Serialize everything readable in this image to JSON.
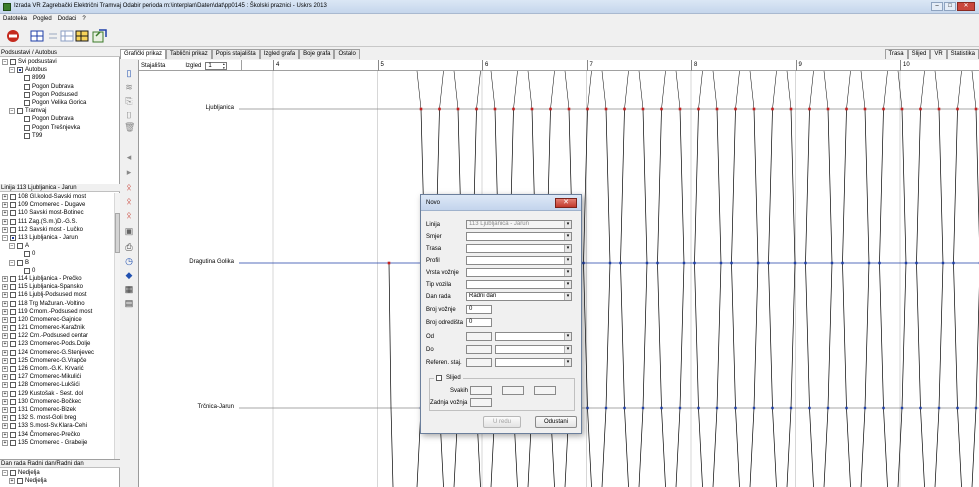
{
  "window": {
    "title": "Izrada VR  Zagrebački Električni Tramvaj Odabir perioda m:\\interplan\\Daten\\dat\\pp0145 : Školski praznici - Uskrs 2013",
    "minimize": "–",
    "maximize": "□",
    "close": "✕"
  },
  "menu": [
    "Datoteka",
    "Pogled",
    "Dodaci",
    "?"
  ],
  "left": {
    "section1_header": "Podsustavi / Autobus",
    "section1": [
      {
        "label": "Svi podsustavi",
        "level": 0,
        "toggle": "−",
        "check": "empty"
      },
      {
        "label": "Autobus",
        "level": 1,
        "toggle": "−",
        "check": "filled"
      },
      {
        "label": "8999",
        "level": 2,
        "toggle": "",
        "check": "empty"
      },
      {
        "label": "Pogon Dubrava",
        "level": 2,
        "toggle": "",
        "check": "empty"
      },
      {
        "label": "Pogon Podsused",
        "level": 2,
        "toggle": "",
        "check": "empty"
      },
      {
        "label": "Pogon Velika Gorica",
        "level": 2,
        "toggle": "",
        "check": "empty"
      },
      {
        "label": "Tramvaj",
        "level": 1,
        "toggle": "−",
        "check": "empty"
      },
      {
        "label": "Pogon Dubrava",
        "level": 2,
        "toggle": "",
        "check": "empty"
      },
      {
        "label": "Pogon Trešnjevka",
        "level": 2,
        "toggle": "",
        "check": "empty"
      },
      {
        "label": "T99",
        "level": 2,
        "toggle": "",
        "check": "empty"
      }
    ],
    "section2_header": "Linija  113 Ljubljanica - Jarun",
    "section2": [
      {
        "label": "108 Gl.kolod-Savski most",
        "level": 0,
        "toggle": "+",
        "check": "empty"
      },
      {
        "label": "109 Črnomerec - Dugave",
        "level": 0,
        "toggle": "+",
        "check": "empty"
      },
      {
        "label": "110 Savski most-Botinec",
        "level": 0,
        "toggle": "+",
        "check": "empty"
      },
      {
        "label": "111 Zag.(S.m.)D.-G.S.",
        "level": 0,
        "toggle": "+",
        "check": "empty"
      },
      {
        "label": "112 Savski most - Lučko",
        "level": 0,
        "toggle": "+",
        "check": "empty"
      },
      {
        "label": "113 Ljubljanica - Jarun",
        "level": 0,
        "toggle": "−",
        "check": "filled"
      },
      {
        "label": "A",
        "level": 1,
        "toggle": "−",
        "check": "empty"
      },
      {
        "label": "0",
        "level": 2,
        "toggle": "",
        "check": "empty"
      },
      {
        "label": "B",
        "level": 1,
        "toggle": "−",
        "check": "empty"
      },
      {
        "label": "0",
        "level": 2,
        "toggle": "",
        "check": "empty"
      },
      {
        "label": "114 Ljubljanica - Prečko",
        "level": 0,
        "toggle": "+",
        "check": "empty"
      },
      {
        "label": "115 Ljubljanica-Špansko",
        "level": 0,
        "toggle": "+",
        "check": "empty"
      },
      {
        "label": "116 Ljublj-Podsused most",
        "level": 0,
        "toggle": "+",
        "check": "empty"
      },
      {
        "label": "118 Trg Mažuran.-Voltino",
        "level": 0,
        "toggle": "+",
        "check": "empty"
      },
      {
        "label": "119 Črnom.-Podsused most",
        "level": 0,
        "toggle": "+",
        "check": "empty"
      },
      {
        "label": "120 Črnomerec-Gajnice",
        "level": 0,
        "toggle": "+",
        "check": "empty"
      },
      {
        "label": "121 Črnomerec-Karažnik",
        "level": 0,
        "toggle": "+",
        "check": "empty"
      },
      {
        "label": "122 Črn.-Podsused centar",
        "level": 0,
        "toggle": "+",
        "check": "empty"
      },
      {
        "label": "123 Črnomerec-Pods.Dolje",
        "level": 0,
        "toggle": "+",
        "check": "empty"
      },
      {
        "label": "124 Črnomerec-G.Stenjevec",
        "level": 0,
        "toggle": "+",
        "check": "empty"
      },
      {
        "label": "125 Črnomerec-G.Vrapče",
        "level": 0,
        "toggle": "+",
        "check": "empty"
      },
      {
        "label": "126 Črnom.-G.K. Krvarić",
        "level": 0,
        "toggle": "+",
        "check": "empty"
      },
      {
        "label": "127 Črnomerec-Mikulići",
        "level": 0,
        "toggle": "+",
        "check": "empty"
      },
      {
        "label": "128 Črnomerec-Lukšići",
        "level": 0,
        "toggle": "+",
        "check": "empty"
      },
      {
        "label": "129 Kustošak - Šest. dol",
        "level": 0,
        "toggle": "+",
        "check": "empty"
      },
      {
        "label": "130 Črnomerec-Bočkec",
        "level": 0,
        "toggle": "+",
        "check": "empty"
      },
      {
        "label": "131 Črnomerec-Bizek",
        "level": 0,
        "toggle": "+",
        "check": "empty"
      },
      {
        "label": "132 S. most-Goli breg",
        "level": 0,
        "toggle": "+",
        "check": "empty"
      },
      {
        "label": "133 S.most-Sv.Klara-Čehi",
        "level": 0,
        "toggle": "+",
        "check": "empty"
      },
      {
        "label": "134 Črnomerec-Prečko",
        "level": 0,
        "toggle": "+",
        "check": "empty"
      },
      {
        "label": "135 Črnomerec - Grabeije",
        "level": 0,
        "toggle": "+",
        "check": "empty"
      }
    ],
    "section3_header": "Dan rada  Radni dan/Radni dan",
    "section3": [
      {
        "label": "Nedjelja",
        "level": 0,
        "toggle": "−",
        "check": "empty"
      },
      {
        "label": "Nedjelja",
        "level": 1,
        "toggle": "+",
        "check": "empty"
      }
    ]
  },
  "tabs": [
    "Grafički prikaz",
    "Tablični prikaz",
    "Popis stajališta",
    "Izgled grafa",
    "Boje grafa",
    "Ostalo"
  ],
  "right_tabs": [
    "Trasa",
    "Slijed",
    "VR",
    "Statistika"
  ],
  "chart": {
    "col_staj": "Stajališta",
    "col_izgled": "Izgled",
    "izgled_value": "1",
    "hours": [
      "4",
      "5",
      "6",
      "7",
      "8",
      "9",
      "10"
    ],
    "stations": [
      "Ljubljanica",
      "Dragutina Golika",
      "Trčnica-Jarun"
    ]
  },
  "dialog": {
    "title": "Novo",
    "close": "✕",
    "fields": {
      "linija_label": "Linija",
      "linija_value": "113 Ljubljanica - Jarun",
      "smjer_label": "Smjer",
      "trasa_label": "Trasa",
      "profil_label": "Profil",
      "vrsta_label": "Vrsta vožnje",
      "tip_label": "Tip vozila",
      "dan_label": "Dan rada",
      "dan_value": "Radni dan",
      "broj_voznje_label": "Broj vožnje",
      "broj_voznje_value": "0",
      "broj_odredista_label": "Broj odredišta",
      "broj_odredista_value": "0",
      "od_label": "Od",
      "do_label": "Do",
      "referen_label": "Referen. staj.",
      "slijed_label": "Slijed",
      "svakih_label": "Svakih",
      "zadnja_label": "Zadnja vožnja"
    },
    "ok_label": "U redu",
    "cancel_label": "Odustani"
  },
  "colors": {
    "trip_line": "#000000",
    "stop_marker": "#c41e1e",
    "station_line": "#1f3fa8",
    "selected_check": "#1f3fa8"
  }
}
